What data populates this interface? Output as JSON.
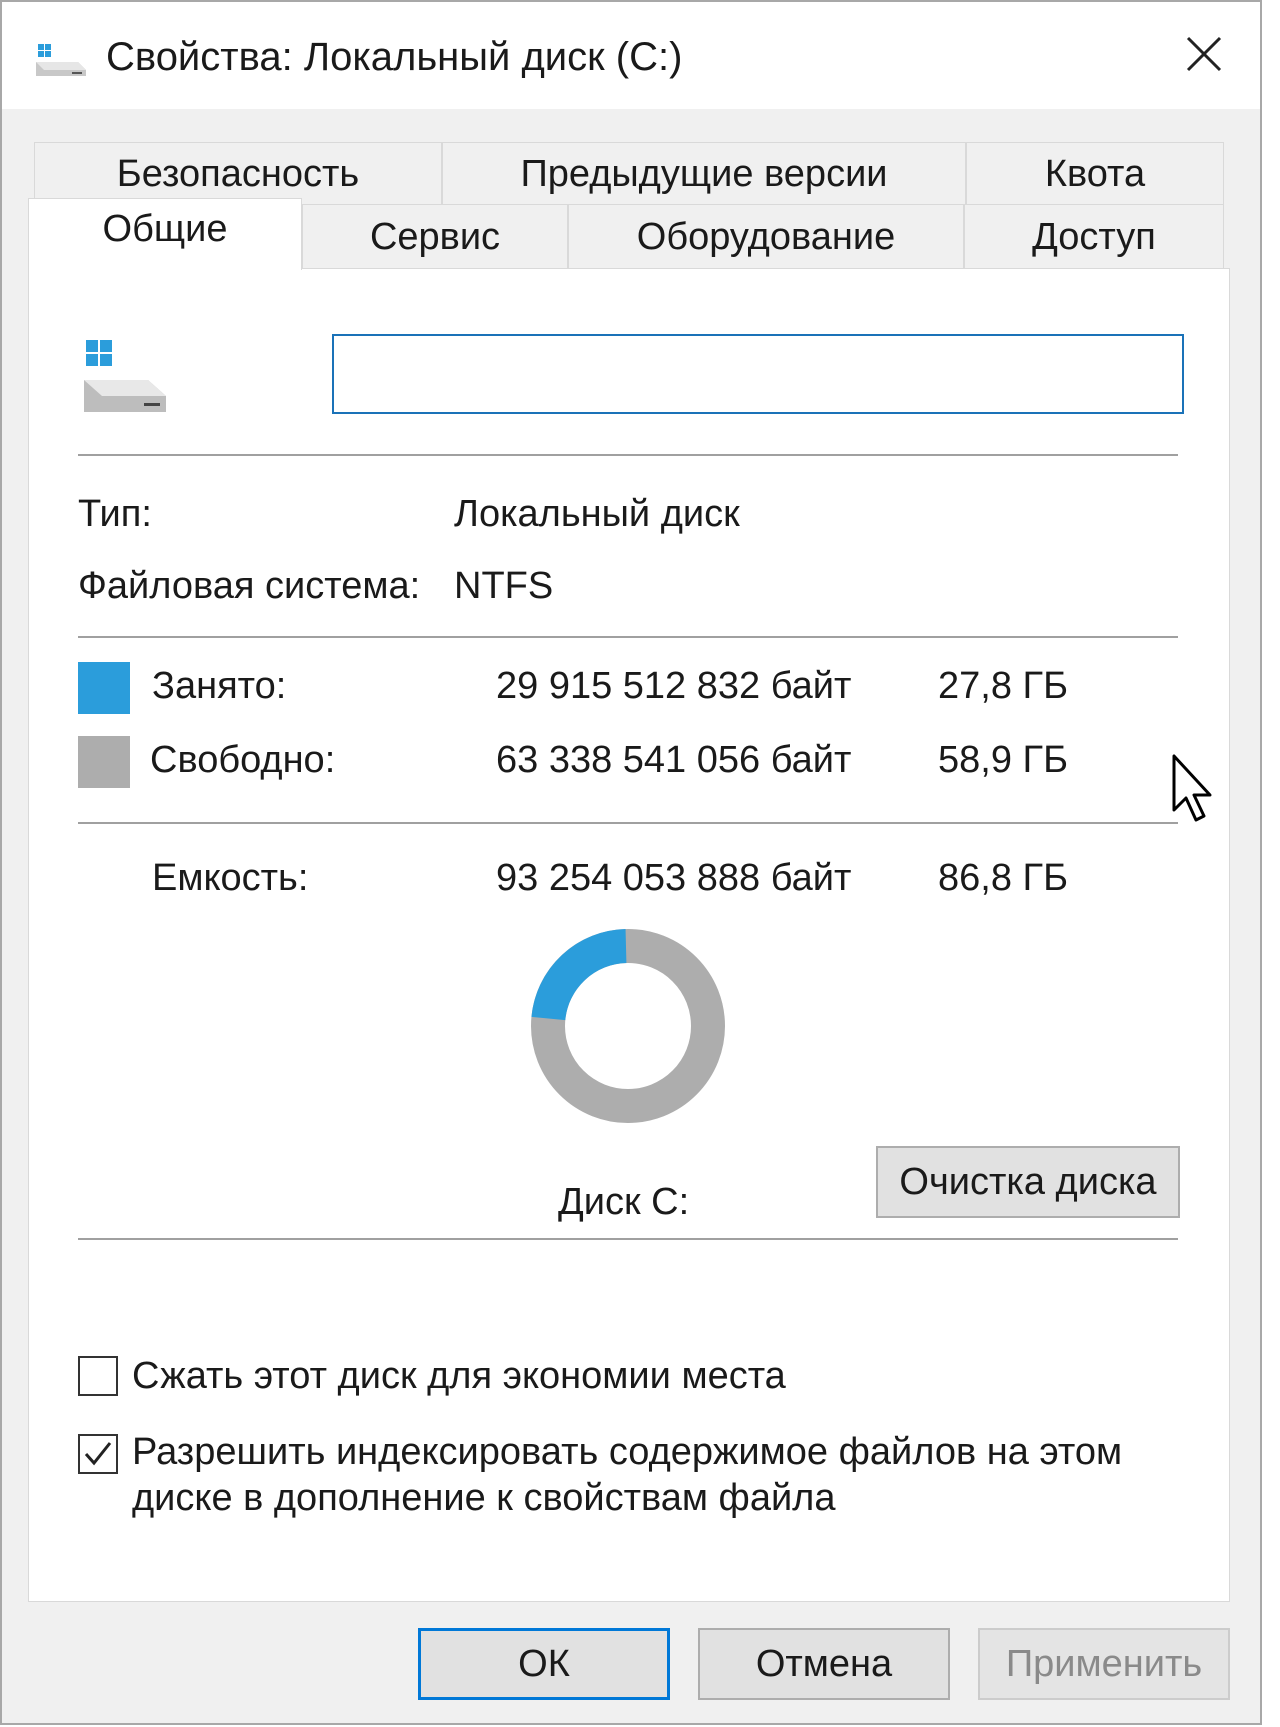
{
  "window": {
    "title": "Свойства: Локальный диск (C:)",
    "close_icon": "close-icon"
  },
  "tabs": {
    "row1": [
      "Безопасность",
      "Предыдущие версии",
      "Квота"
    ],
    "row2": [
      "Общие",
      "Сервис",
      "Оборудование",
      "Доступ"
    ],
    "active": "Общие"
  },
  "general": {
    "volume_label_value": "",
    "type_label": "Тип:",
    "type_value": "Локальный диск",
    "fs_label": "Файловая система:",
    "fs_value": "NTFS",
    "used_label": "Занято:",
    "used_bytes": "29 915 512 832 байт",
    "used_size": "27,8 ГБ",
    "free_label": "Свободно:",
    "free_bytes": "63 338 541 056 байт",
    "free_size": "58,9 ГБ",
    "capacity_label": "Емкость:",
    "capacity_bytes": "93 254 053 888 байт",
    "capacity_size": "86,8 ГБ",
    "disk_label": "Диск C:",
    "cleanup_button": "Очистка диска",
    "used_fraction": 0.3208,
    "used_color": "#2b9ddb",
    "free_color": "#adadad"
  },
  "options": {
    "compress_label": "Сжать этот диск для экономии места",
    "compress_checked": false,
    "index_label_line1": "Разрешить индексировать содержимое файлов на этом",
    "index_label_line2": "диске в дополнение к свойствам файла",
    "index_checked": true
  },
  "footer": {
    "ok": "ОК",
    "cancel": "Отмена",
    "apply": "Применить"
  }
}
